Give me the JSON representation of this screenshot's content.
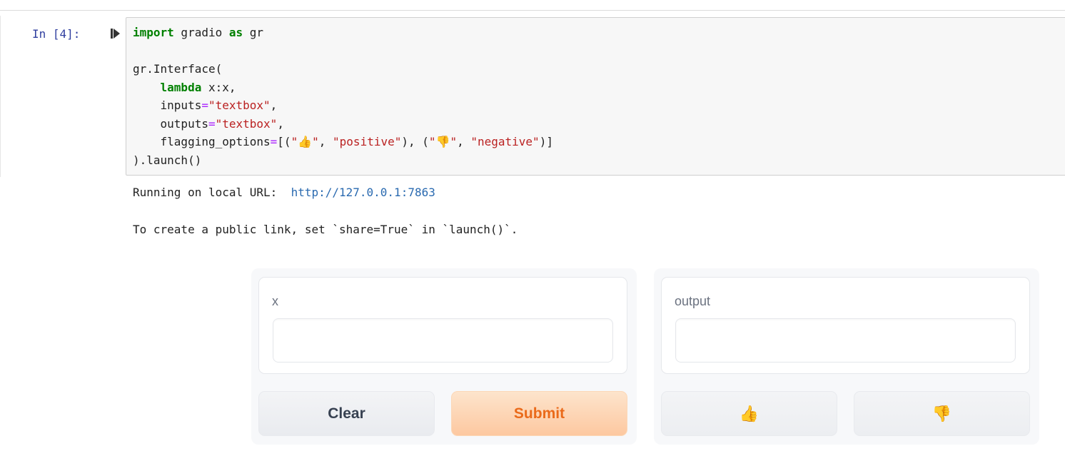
{
  "notebook": {
    "prompt": "In [4]:",
    "code_lines": [
      [
        {
          "t": "import",
          "c": "kw"
        },
        {
          "t": " gradio ",
          "c": ""
        },
        {
          "t": "as",
          "c": "kw"
        },
        {
          "t": " gr",
          "c": ""
        }
      ],
      [],
      [
        {
          "t": "gr.Interface(",
          "c": ""
        }
      ],
      [
        {
          "t": "    ",
          "c": ""
        },
        {
          "t": "lambda",
          "c": "kw"
        },
        {
          "t": " x:x,",
          "c": ""
        }
      ],
      [
        {
          "t": "    inputs",
          "c": ""
        },
        {
          "t": "=",
          "c": "op"
        },
        {
          "t": "\"textbox\"",
          "c": "str"
        },
        {
          "t": ",",
          "c": ""
        }
      ],
      [
        {
          "t": "    outputs",
          "c": ""
        },
        {
          "t": "=",
          "c": "op"
        },
        {
          "t": "\"textbox\"",
          "c": "str"
        },
        {
          "t": ",",
          "c": ""
        }
      ],
      [
        {
          "t": "    flagging_options",
          "c": ""
        },
        {
          "t": "=",
          "c": "op"
        },
        {
          "t": "[(",
          "c": ""
        },
        {
          "t": "\"",
          "c": "str"
        },
        {
          "t": "👍",
          "c": "emoji"
        },
        {
          "t": "\"",
          "c": "str"
        },
        {
          "t": ", ",
          "c": ""
        },
        {
          "t": "\"positive\"",
          "c": "str"
        },
        {
          "t": "), (",
          "c": ""
        },
        {
          "t": "\"",
          "c": "str"
        },
        {
          "t": "👎",
          "c": "emoji"
        },
        {
          "t": "\"",
          "c": "str"
        },
        {
          "t": ", ",
          "c": ""
        },
        {
          "t": "\"negative\"",
          "c": "str"
        },
        {
          "t": ")]",
          "c": ""
        }
      ],
      [
        {
          "t": ").launch()",
          "c": ""
        }
      ]
    ],
    "output": {
      "running_prefix": "Running on local URL:  ",
      "url": "http://127.0.0.1:7863",
      "share_hint": "To create a public link, set `share=True` in `launch()`."
    }
  },
  "gradio": {
    "input_label": "x",
    "input_value": "",
    "output_label": "output",
    "output_value": "",
    "clear_label": "Clear",
    "submit_label": "Submit",
    "flag_positive": "👍",
    "flag_negative": "👎"
  },
  "colors": {
    "prompt": "#303f9f",
    "keyword": "#008000",
    "string": "#ba2121",
    "operator": "#aa22ff",
    "url": "#2a6ab0",
    "submit_text": "#ea6a1a"
  }
}
